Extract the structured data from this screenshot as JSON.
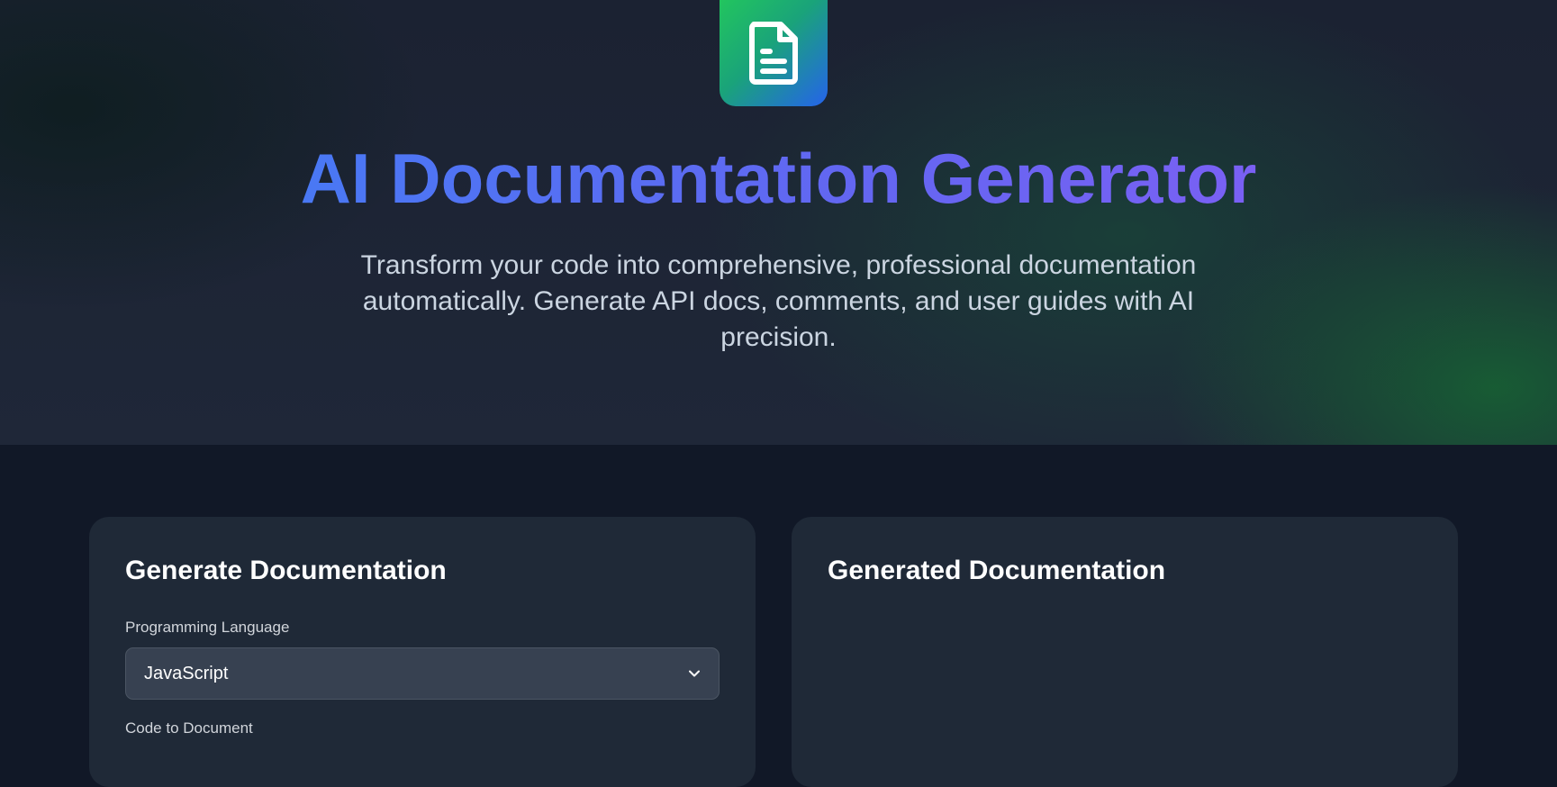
{
  "hero": {
    "logo_icon": "document-icon",
    "title": "AI Documentation Generator",
    "subtitle": "Transform your code into comprehensive, professional documentation automatically. Generate API docs, comments, and user guides with AI precision."
  },
  "left_panel": {
    "heading": "Generate Documentation",
    "language_label": "Programming Language",
    "language_selected": "JavaScript",
    "code_label": "Code to Document"
  },
  "right_panel": {
    "heading": "Generated Documentation"
  },
  "colors": {
    "page_bg": "#111827",
    "card_bg": "#1f2937",
    "title_gradient_start": "#3b82f6",
    "title_gradient_end": "#8b5cf6",
    "logo_gradient_start": "#22c55e",
    "logo_gradient_end": "#2563eb"
  }
}
